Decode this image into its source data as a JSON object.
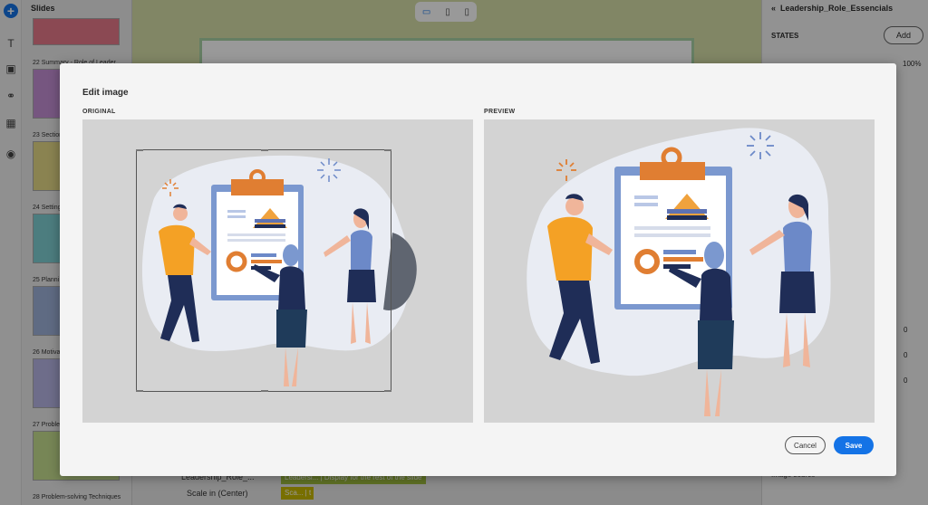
{
  "left_rail": {
    "icons": [
      "add-icon",
      "text-icon",
      "media-icon",
      "interactions-icon",
      "widgets-icon",
      "record-icon"
    ]
  },
  "slides_panel": {
    "title": "Slides",
    "items": [
      {
        "label": "22 Summary - Role of Leader",
        "color": "#c58fd6"
      },
      {
        "label": "23 Section",
        "color": "#e6db87"
      },
      {
        "label": "24 Setting",
        "color": "#7fd0d4"
      },
      {
        "label": "25 Planni",
        "color": "#9eb2db"
      },
      {
        "label": "26 Motiva",
        "color": "#b7b6e6"
      },
      {
        "label": "27 Proble",
        "color": "#c6e08f"
      },
      {
        "label": "28 Problem-solving Techniques",
        "color": "#e0e0e0"
      }
    ]
  },
  "device_bar": {
    "icons": [
      "desktop-icon",
      "tablet-icon",
      "mobile-icon"
    ]
  },
  "timeline": {
    "rows": [
      "Leadership_Role_...",
      "Scale in (Center)"
    ],
    "chip_labels": [
      "Leadersl... | Display for the rest of the slide",
      "Sca... | t"
    ]
  },
  "props_panel": {
    "title": "Leadership_Role_Essencials",
    "states_label": "STATES",
    "add_label": "Add",
    "zoom": "100%",
    "numbers": [
      "0",
      "0",
      "0"
    ],
    "image_source_label": "Image source"
  },
  "modal": {
    "title": "Edit image",
    "original_label": "ORIGINAL",
    "preview_label": "PREVIEW",
    "cancel_label": "Cancel",
    "save_label": "Save"
  },
  "colors": {
    "accent": "#1473e6",
    "blob": "#e9ecf3",
    "orange": "#ef8d2b",
    "navy": "#1f2d57",
    "blue": "#6c89c8",
    "skin": "#f0b59a"
  }
}
